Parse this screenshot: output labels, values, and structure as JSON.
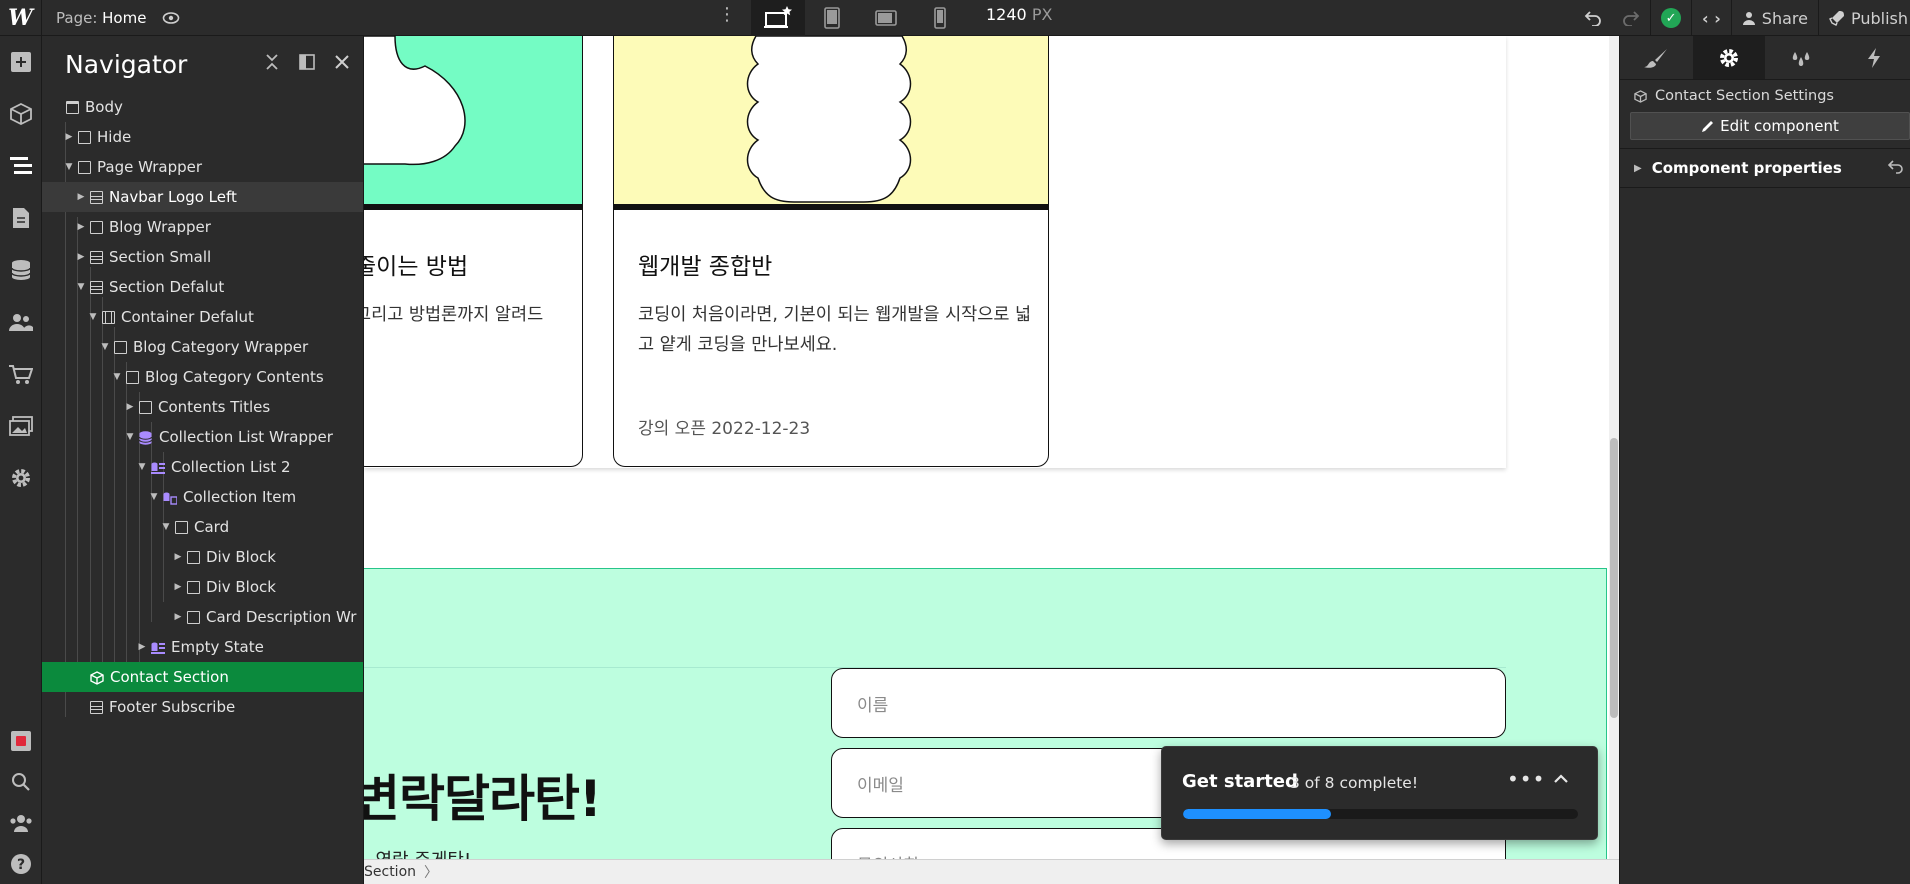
{
  "topbar": {
    "logo": "W",
    "page_prefix": "Page:",
    "page_name": "Home",
    "width_value": "1240",
    "width_unit": "PX",
    "share_label": "Share",
    "publish_label": "Publish"
  },
  "navigator": {
    "title": "Navigator",
    "items": [
      {
        "label": "Body"
      },
      {
        "label": "Hide"
      },
      {
        "label": "Page Wrapper"
      },
      {
        "label": "Navbar Logo Left"
      },
      {
        "label": "Blog Wrapper"
      },
      {
        "label": "Section Small"
      },
      {
        "label": "Section Defalut"
      },
      {
        "label": "Container Defalut"
      },
      {
        "label": "Blog Category Wrapper"
      },
      {
        "label": "Blog Category Contents"
      },
      {
        "label": "Contents Titles"
      },
      {
        "label": "Collection List Wrapper"
      },
      {
        "label": "Collection List 2"
      },
      {
        "label": "Collection Item"
      },
      {
        "label": "Card"
      },
      {
        "label": "Div Block"
      },
      {
        "label": "Div Block"
      },
      {
        "label": "Card Description Wr"
      },
      {
        "label": "Empty State"
      },
      {
        "label": "Contact Section"
      },
      {
        "label": "Footer Subscribe"
      }
    ]
  },
  "canvas": {
    "card1": {
      "title": "줄이는 방법",
      "desc": "그리고 방법론까지 알려드"
    },
    "card2": {
      "title": "웹개발 종합반",
      "desc": "코딩이 처음이라면, 기본이 되는 웹개발을 시작으로 넓고 얕게 코딩을 만나보세요.",
      "date": "강의 오픈 2022-12-23"
    },
    "contact_title": "변락달라탄!",
    "contact_sub": ", 연락 주게탄!",
    "field_name_placeholder": "이름",
    "field_email_placeholder": "이메일",
    "field_inquiry_placeholder": "문의사항"
  },
  "breadcrumb": {
    "item": "Section"
  },
  "right_panel": {
    "settings_label": "Contact Section Settings",
    "edit_button": "Edit component",
    "section_label": "Component properties"
  },
  "get_started": {
    "title": "Get started",
    "count": "3 of 8 complete!",
    "progress": 0.375
  },
  "colors": {
    "accent_green": "#0b8a3d",
    "progress_blue": "#1e90ff",
    "card1_image": "#74fcc4",
    "card2_image": "#fdfbb8",
    "contact_bg": "#bdfedf"
  }
}
